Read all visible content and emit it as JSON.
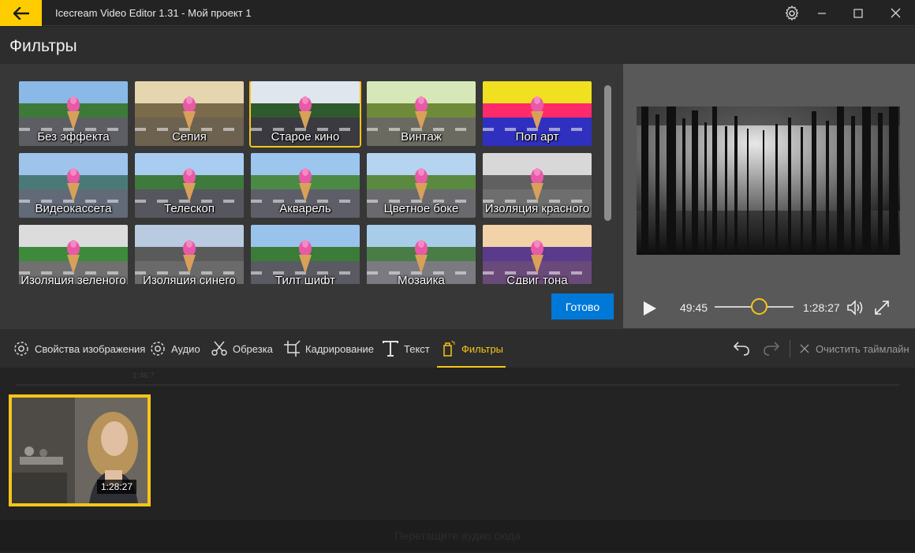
{
  "window": {
    "title": "Icecream Video Editor 1.31 - Мой проект 1"
  },
  "page": {
    "title": "Фильтры"
  },
  "filters": [
    {
      "label": "Без эффекта",
      "sky": "#8ab9e8",
      "hill": "#3d7a3a",
      "road": "#5d5d64",
      "selected": false
    },
    {
      "label": "Сепия",
      "sky": "#e6d6b0",
      "hill": "#7b6b4b",
      "road": "#6d6250",
      "selected": false
    },
    {
      "label": "Старое кино",
      "sky": "#e0e6ee",
      "hill": "#2f5a2d",
      "road": "#3a3a40",
      "selected": true
    },
    {
      "label": "Винтаж",
      "sky": "#d6e8b8",
      "hill": "#6f8a3a",
      "road": "#6a6a60",
      "selected": false
    },
    {
      "label": "Поп арт",
      "sky": "#f0e020",
      "hill": "#ff2a6a",
      "road": "#3030c0",
      "selected": false
    },
    {
      "label": "Видеокассета",
      "sky": "#9ec4ec",
      "hill": "#4a7a78",
      "road": "#626a78",
      "selected": false
    },
    {
      "label": "Телескоп",
      "sky": "#a8cdf0",
      "hill": "#3e7a3c",
      "road": "#56565e",
      "selected": false
    },
    {
      "label": "Акварель",
      "sky": "#9cc6ee",
      "hill": "#4b8a44",
      "road": "#5e5e68",
      "selected": false
    },
    {
      "label": "Цветное боке",
      "sky": "#b4d4f0",
      "hill": "#5a8a40",
      "road": "#6a6a6e",
      "selected": false
    },
    {
      "label": "Изоляция красного",
      "sky": "#d8d8d8",
      "hill": "#606060",
      "road": "#6e6e6e",
      "selected": false
    },
    {
      "label": "Изоляция зеленого",
      "sky": "#dcdcdc",
      "hill": "#3d8a3a",
      "road": "#707070",
      "selected": false
    },
    {
      "label": "Изоляция синего",
      "sky": "#b8cbe0",
      "hill": "#5a5a5a",
      "road": "#6a6a6a",
      "selected": false
    },
    {
      "label": "Тилт шифт",
      "sky": "#9ac3ec",
      "hill": "#3a7c38",
      "road": "#5a5a62",
      "selected": false
    },
    {
      "label": "Мозаика",
      "sky": "#a8cde8",
      "hill": "#4a7c48",
      "road": "#7a7a80",
      "selected": false
    },
    {
      "label": "Сдвиг тона",
      "sky": "#f2d2a8",
      "hill": "#5a3a8a",
      "road": "#6a4a7a",
      "selected": false
    }
  ],
  "done_button": "Готово",
  "player": {
    "current_time": "49:45",
    "total_time": "1:28:27",
    "progress": 0.56
  },
  "toolbar": {
    "items": [
      {
        "label": "Свойства изображения",
        "icon": "gear-icon"
      },
      {
        "label": "Аудио",
        "icon": "gear-icon"
      },
      {
        "label": "Обрезка",
        "icon": "scissors-icon"
      },
      {
        "label": "Кадрирование",
        "icon": "crop-icon"
      },
      {
        "label": "Текст",
        "icon": "text-icon"
      },
      {
        "label": "Фильтры",
        "icon": "filter-icon"
      }
    ],
    "clear_timeline": "Очистить таймлайн"
  },
  "timeline": {
    "ruler_label": "1:46:7",
    "clip_duration": "1:28:27",
    "audio_drop_hint": "Перетащите аудио сюда"
  },
  "colors": {
    "accent": "#f5c518",
    "primary_button": "#0078d7",
    "back_button": "#ffcc00"
  }
}
